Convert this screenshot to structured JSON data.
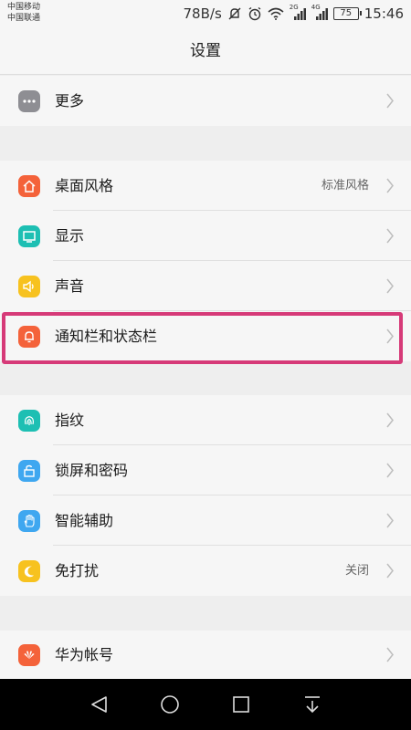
{
  "status_bar": {
    "carrier1": "中国移动",
    "carrier2": "中国联通",
    "speed": "78B/s",
    "net1": "2G",
    "net2": "4G",
    "battery": "75",
    "time": "15:46"
  },
  "title": "设置",
  "items": [
    {
      "label": "更多",
      "value": "",
      "color": "#8e8e93",
      "icon": "more-icon"
    },
    {
      "label": "桌面风格",
      "value": "标准风格",
      "color": "#f4623a",
      "icon": "home-icon"
    },
    {
      "label": "显示",
      "value": "",
      "color": "#1dbfb3",
      "icon": "display-icon"
    },
    {
      "label": "声音",
      "value": "",
      "color": "#f7c21f",
      "icon": "sound-icon"
    },
    {
      "label": "通知栏和状态栏",
      "value": "",
      "color": "#f4623a",
      "icon": "bell-icon"
    },
    {
      "label": "指纹",
      "value": "",
      "color": "#1dbfb3",
      "icon": "fingerprint-icon"
    },
    {
      "label": "锁屏和密码",
      "value": "",
      "color": "#3fa7f0",
      "icon": "lock-icon"
    },
    {
      "label": "智能辅助",
      "value": "",
      "color": "#3fa7f0",
      "icon": "hand-icon"
    },
    {
      "label": "免打扰",
      "value": "关闭",
      "color": "#f7c21f",
      "icon": "moon-icon"
    },
    {
      "label": "华为帐号",
      "value": "",
      "color": "#f4623a",
      "icon": "huawei-icon"
    }
  ]
}
